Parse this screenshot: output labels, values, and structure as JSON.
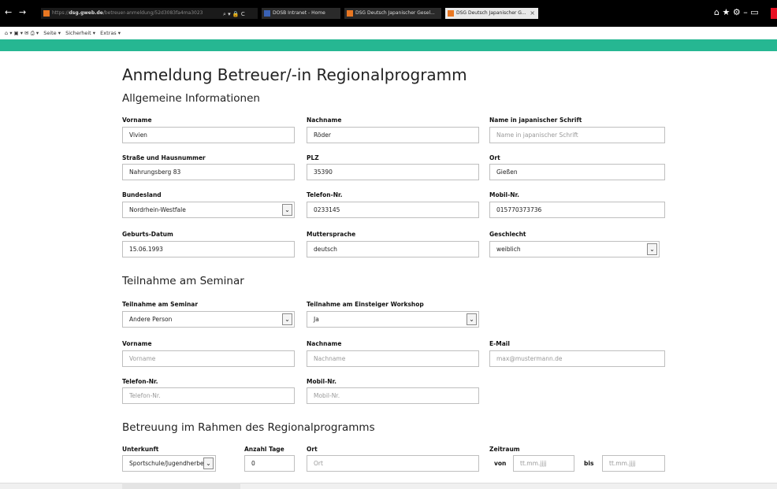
{
  "browser": {
    "url_prefix": "https://",
    "url_domain": "dsg.gweb.de",
    "url_rest": "/betreuer-anmeldung/52d3083fa4ma3023",
    "tabs": [
      {
        "label": "DOSB Intranet - Home",
        "fav_color": "#3a62b5"
      },
      {
        "label": "DSG Deutsch Japanischer Gesel...",
        "fav_color": "#e87722"
      },
      {
        "label": "DSG Deutsch Japanischer G...",
        "fav_color": "#e87722"
      }
    ],
    "tab_close": "×",
    "nav_back": "←",
    "nav_forward": "→",
    "url_controls": "⌕ ▾ 🔒 C",
    "window_icons": "⌂ ★ ⚙  –  ▭",
    "commandbar": [
      "Seite ▾",
      "Sicherheit ▾",
      "Extras ▾"
    ],
    "commandbar_icons": "⌂ ▾ ▣ ▾ ✉ ⎙ ▾",
    "accent": "#26b792"
  },
  "page": {
    "title": "Anmeldung Betreuer/-in Regionalprogramm",
    "sections": {
      "general": "Allgemeine Informationen",
      "seminar": "Teilnahme am Seminar",
      "support": "Betreuung im Rahmen des Regionalprogramms"
    }
  },
  "general": {
    "vorname": {
      "label": "Vorname",
      "value": "Vivien"
    },
    "nachname": {
      "label": "Nachname",
      "value": "Röder"
    },
    "japan_name": {
      "label": "Name in japanischer Schrift",
      "placeholder": "Name in japanischer Schrift"
    },
    "strasse": {
      "label": "Straße und Hausnummer",
      "value": "Nahrungsberg 83"
    },
    "plz": {
      "label": "PLZ",
      "value": "35390"
    },
    "ort": {
      "label": "Ort",
      "value": "Gießen"
    },
    "bundesland": {
      "label": "Bundesland",
      "value": "Nordrhein-Westfale"
    },
    "telefon": {
      "label": "Telefon-Nr.",
      "value": "0233145"
    },
    "mobil": {
      "label": "Mobil-Nr.",
      "value": "015770373736"
    },
    "geburt": {
      "label": "Geburts-Datum",
      "value": "15.06.1993"
    },
    "mutter": {
      "label": "Muttersprache",
      "value": "deutsch"
    },
    "geschlecht": {
      "label": "Geschlecht",
      "value": "weiblich"
    }
  },
  "seminar": {
    "teilnahme": {
      "label": "Teilnahme am Seminar",
      "value": "Andere Person"
    },
    "workshop": {
      "label": "Teilnahme am Einsteiger Workshop",
      "value": "Ja"
    },
    "vorname": {
      "label": "Vorname",
      "placeholder": "Vorname"
    },
    "nachname": {
      "label": "Nachname",
      "placeholder": "Nachname"
    },
    "email": {
      "label": "E-Mail",
      "placeholder": "max@mustermann.de"
    },
    "telefon": {
      "label": "Telefon-Nr.",
      "placeholder": "Telefon-Nr."
    },
    "mobil": {
      "label": "Mobil-Nr.",
      "placeholder": "Mobil-Nr."
    }
  },
  "support": {
    "unterkunft": {
      "label": "Unterkunft",
      "value": "Sportschule/Jugendherber"
    },
    "tage": {
      "label": "Anzahl Tage",
      "value": "0"
    },
    "ort": {
      "label": "Ort",
      "placeholder": "Ort"
    },
    "zeitraum": {
      "label": "Zeitraum",
      "von": "von",
      "bis": "bis",
      "placeholder": "tt.mm.jjjj"
    }
  },
  "select_arrow": "⌄"
}
